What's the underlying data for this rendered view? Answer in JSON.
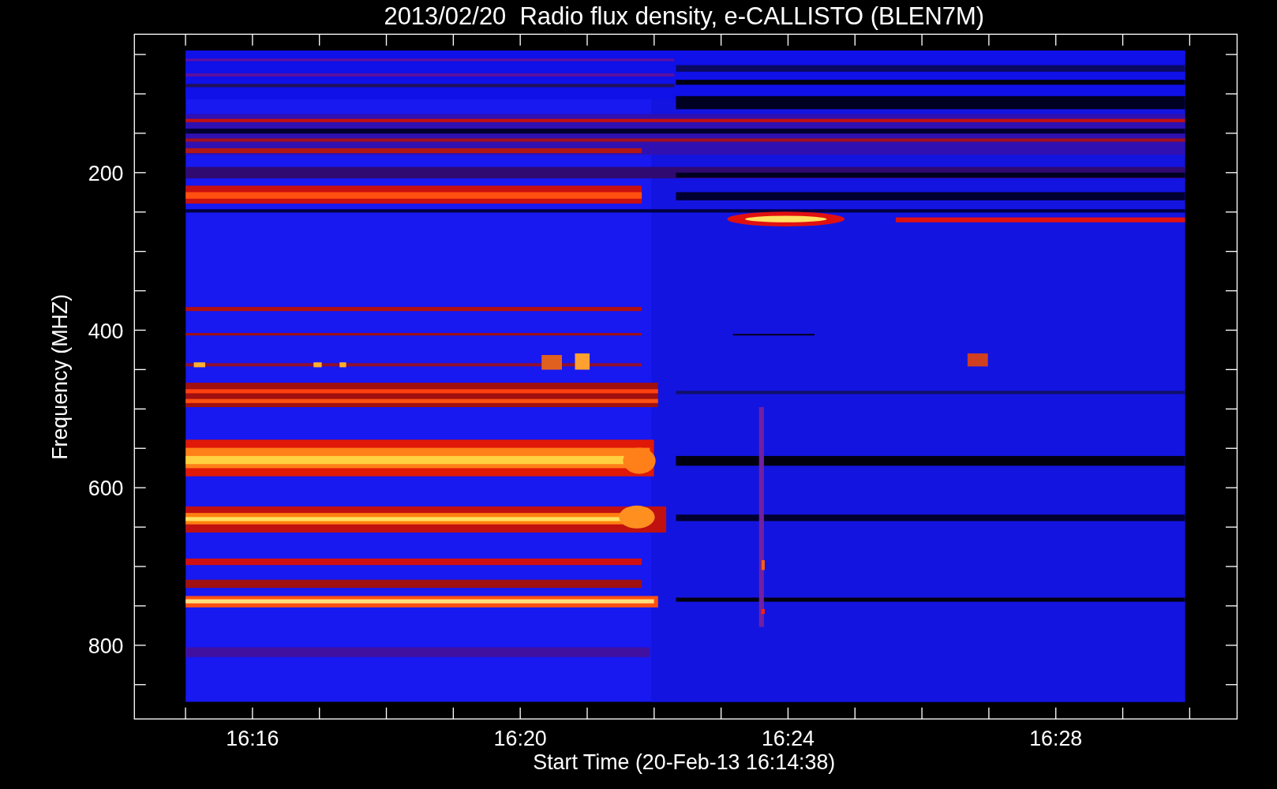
{
  "title": "2013/02/20  Radio flux density, e-CALLISTO (BLEN7M)",
  "y_axis": {
    "label": "Frequency (MHZ)",
    "ticks": [
      "200",
      "400",
      "600",
      "800"
    ]
  },
  "x_axis": {
    "label": "Start Time (20-Feb-13 16:14:38)",
    "ticks": [
      "16:16",
      "16:20",
      "16:24",
      "16:28"
    ]
  }
}
